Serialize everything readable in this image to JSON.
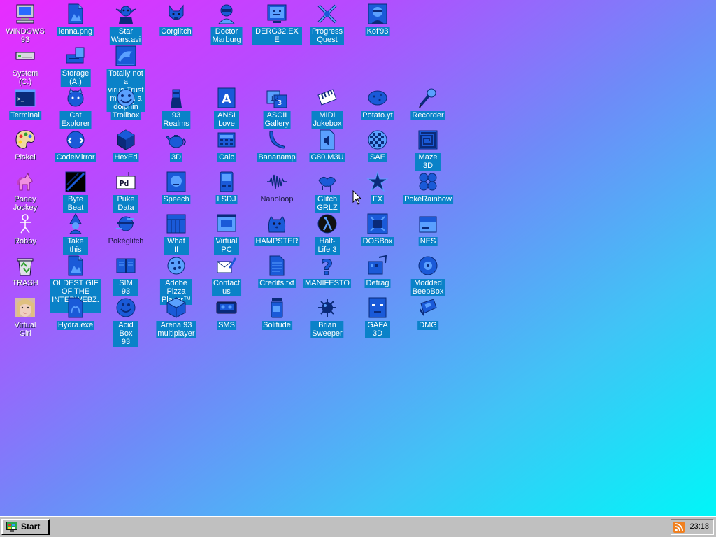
{
  "desktop": {
    "icons": [
      {
        "id": "windows93",
        "label": "WINDOWS 93",
        "icon": "computer-icon",
        "col": 0,
        "row": 0,
        "style": "plain"
      },
      {
        "id": "lenna",
        "label": "lenna.png",
        "icon": "image-file-icon",
        "col": 1,
        "row": 0
      },
      {
        "id": "starwars",
        "label": "Star Wars.avi",
        "icon": "yoda-icon",
        "col": 2,
        "row": 0
      },
      {
        "id": "corglitch",
        "label": "Corglitch",
        "icon": "corgi-icon",
        "col": 3,
        "row": 0
      },
      {
        "id": "marburg",
        "label": "Doctor Marburg",
        "icon": "doctor-icon",
        "col": 4,
        "row": 0
      },
      {
        "id": "derg32",
        "label": "DERG32.EXE",
        "icon": "monitor-face-icon",
        "col": 5,
        "row": 0
      },
      {
        "id": "progressquest",
        "label": "Progress Quest",
        "icon": "crossed-swords-icon",
        "col": 6,
        "row": 0
      },
      {
        "id": "kof93",
        "label": "Kof'93",
        "icon": "fighter-portrait-icon",
        "col": 7,
        "row": 0
      },
      {
        "id": "system",
        "label": "System (C:)",
        "icon": "hard-drive-icon",
        "col": 0,
        "row": 1,
        "style": "plain"
      },
      {
        "id": "storage",
        "label": "Storage (A:)",
        "icon": "floppy-drive-icon",
        "col": 1,
        "row": 1
      },
      {
        "id": "dolphin",
        "label": "Totally not a virus.Trust me...im a dolphin",
        "icon": "dolphin-icon",
        "col": 2,
        "row": 1
      },
      {
        "id": "terminal",
        "label": "Terminal",
        "icon": "terminal-icon",
        "col": 0,
        "row": 2
      },
      {
        "id": "catexplorer",
        "label": "Cat Explorer",
        "icon": "cat-globe-icon",
        "col": 1,
        "row": 2
      },
      {
        "id": "trollbox",
        "label": "Trollbox",
        "icon": "troll-icon",
        "col": 2,
        "row": 2
      },
      {
        "id": "93realms",
        "label": "93 Realms",
        "icon": "knight-icon",
        "col": 3,
        "row": 2
      },
      {
        "id": "ansilove",
        "label": "ANSI Love",
        "icon": "letter-a-icon",
        "col": 4,
        "row": 2
      },
      {
        "id": "asciigallery",
        "label": "ASCII Gallery",
        "icon": "number-blocks-icon",
        "col": 5,
        "row": 2
      },
      {
        "id": "midijukebox",
        "label": "MIDI Jukebox",
        "icon": "piano-keys-icon",
        "col": 6,
        "row": 2
      },
      {
        "id": "potato",
        "label": "Potato.yt",
        "icon": "potato-icon",
        "col": 7,
        "row": 2
      },
      {
        "id": "recorder",
        "label": "Recorder",
        "icon": "microphone-icon",
        "col": 8,
        "row": 2
      },
      {
        "id": "piskel",
        "label": "Piskel",
        "icon": "palette-icon",
        "col": 0,
        "row": 3,
        "style": "plain"
      },
      {
        "id": "codemirror",
        "label": "CodeMirror",
        "icon": "code-globe-icon",
        "col": 1,
        "row": 3
      },
      {
        "id": "hexed",
        "label": "HexEd",
        "icon": "hex-cube-icon",
        "col": 2,
        "row": 3
      },
      {
        "id": "3d",
        "label": "3D",
        "icon": "teapot-icon",
        "col": 3,
        "row": 3
      },
      {
        "id": "calc",
        "label": "Calc",
        "icon": "calculator-icon",
        "col": 4,
        "row": 3
      },
      {
        "id": "bananamp",
        "label": "Bananamp",
        "icon": "banana-icon",
        "col": 5,
        "row": 3
      },
      {
        "id": "g80m3u",
        "label": "G80.M3U",
        "icon": "audio-file-icon",
        "col": 6,
        "row": 3
      },
      {
        "id": "sae",
        "label": "SAE",
        "icon": "checker-ball-icon",
        "col": 7,
        "row": 3
      },
      {
        "id": "maze3d",
        "label": "Maze 3D",
        "icon": "maze-icon",
        "col": 8,
        "row": 3
      },
      {
        "id": "poneyjockey",
        "label": "Poney Jockey",
        "icon": "pony-icon",
        "col": 0,
        "row": 4,
        "style": "plain"
      },
      {
        "id": "bytebeat",
        "label": "Byte Beat",
        "icon": "byte-beat-icon",
        "col": 1,
        "row": 4
      },
      {
        "id": "pukedata",
        "label": "Puke Data",
        "icon": "pd-patch-icon",
        "col": 2,
        "row": 4
      },
      {
        "id": "speech",
        "label": "Speech",
        "icon": "speaking-face-icon",
        "col": 3,
        "row": 4
      },
      {
        "id": "lsdj",
        "label": "LSDJ",
        "icon": "gameboy-icon",
        "col": 4,
        "row": 4
      },
      {
        "id": "nanoloop",
        "label": "Nanoloop",
        "icon": "waveform-icon",
        "col": 5,
        "row": 4,
        "style": "plain"
      },
      {
        "id": "glitchgrlz",
        "label": "Glitch GRLZ",
        "icon": "glitch-lips-icon",
        "col": 6,
        "row": 4
      },
      {
        "id": "fx",
        "label": "FX",
        "icon": "star-burst-icon",
        "col": 7,
        "row": 4
      },
      {
        "id": "pokerainbow",
        "label": "PokéRainbow",
        "icon": "pokemon-group-icon",
        "col": 8,
        "row": 4
      },
      {
        "id": "robby",
        "label": "Robby",
        "icon": "stick-figure-icon",
        "col": 0,
        "row": 5,
        "style": "plain"
      },
      {
        "id": "takethis",
        "label": "Take this",
        "icon": "wizard-icon",
        "col": 1,
        "row": 5
      },
      {
        "id": "pokeglitch",
        "label": "Pokéglitch",
        "icon": "glitch-ball-icon",
        "col": 2,
        "row": 5,
        "style": "plain"
      },
      {
        "id": "whatif",
        "label": "What If",
        "icon": "grid-window-icon",
        "col": 3,
        "row": 5
      },
      {
        "id": "virtualpc",
        "label": "Virtual PC",
        "icon": "pc-window-icon",
        "col": 4,
        "row": 5
      },
      {
        "id": "hampster",
        "label": "HAMPSTER",
        "icon": "hamster-icon",
        "col": 5,
        "row": 5
      },
      {
        "id": "halflife3",
        "label": "Half-Life 3",
        "icon": "lambda-icon",
        "col": 6,
        "row": 5
      },
      {
        "id": "dosbox",
        "label": "DOSBox",
        "icon": "dosbox-icon",
        "col": 7,
        "row": 5
      },
      {
        "id": "nes",
        "label": "NES",
        "icon": "nes-console-icon",
        "col": 8,
        "row": 5
      },
      {
        "id": "trash",
        "label": "TRASH",
        "icon": "recycle-bin-icon",
        "col": 0,
        "row": 6,
        "style": "plain"
      },
      {
        "id": "oldestgif",
        "label": "OLDEST GIF OF THE INTERWEBZ.gif",
        "icon": "image-file-icon",
        "col": 1,
        "row": 6
      },
      {
        "id": "sim93",
        "label": "SIM 93",
        "icon": "book-icon",
        "col": 2,
        "row": 6
      },
      {
        "id": "adobepizza",
        "label": "Adobe Pizza Player™",
        "icon": "pizza-icon",
        "col": 3,
        "row": 6
      },
      {
        "id": "contactus",
        "label": "Contact us",
        "icon": "write-letter-icon",
        "col": 4,
        "row": 6
      },
      {
        "id": "credits",
        "label": "Credits.txt",
        "icon": "text-file-icon",
        "col": 5,
        "row": 6
      },
      {
        "id": "manifesto",
        "label": "MANIFESTO",
        "icon": "question-mark-icon",
        "col": 6,
        "row": 6
      },
      {
        "id": "defrag",
        "label": "Defrag",
        "icon": "defrag-icon",
        "col": 7,
        "row": 6
      },
      {
        "id": "beepbox",
        "label": "Modded BeepBox",
        "icon": "record-disc-icon",
        "col": 8,
        "row": 6
      },
      {
        "id": "virtualgirl",
        "label": "Virtual Girl",
        "icon": "girl-face-icon",
        "col": 0,
        "row": 7,
        "style": "plain"
      },
      {
        "id": "hydra",
        "label": "Hydra.exe",
        "icon": "hydra-icon",
        "col": 1,
        "row": 7
      },
      {
        "id": "acidbox",
        "label": "Acid Box 93",
        "icon": "smiley-icon",
        "col": 2,
        "row": 7
      },
      {
        "id": "arena93",
        "label": "Arena 93 multiplayer",
        "icon": "cube-icon",
        "col": 3,
        "row": 7
      },
      {
        "id": "sms",
        "label": "SMS",
        "icon": "cassette-icon",
        "col": 4,
        "row": 7
      },
      {
        "id": "solitude",
        "label": "Solitude",
        "icon": "jar-icon",
        "col": 5,
        "row": 7
      },
      {
        "id": "briansweeper",
        "label": "Brian Sweeper",
        "icon": "mine-icon",
        "col": 6,
        "row": 7
      },
      {
        "id": "gafa3d",
        "label": "GAFA 3D",
        "icon": "doom-face-icon",
        "col": 7,
        "row": 7
      },
      {
        "id": "dmg",
        "label": "DMG",
        "icon": "game-cartridge-icon",
        "col": 8,
        "row": 7
      }
    ]
  },
  "taskbar": {
    "start_label": "Start",
    "clock": "23:18",
    "tray_icon": "rss-feed-icon"
  },
  "colors": {
    "label_bg": "#0a82c8",
    "icon_blue": "#1a5ad8",
    "icon_dark": "#0a2a7a",
    "taskbar": "#c0c0c0",
    "gradient_start": "#e82cff",
    "gradient_end": "#00f6f8"
  }
}
